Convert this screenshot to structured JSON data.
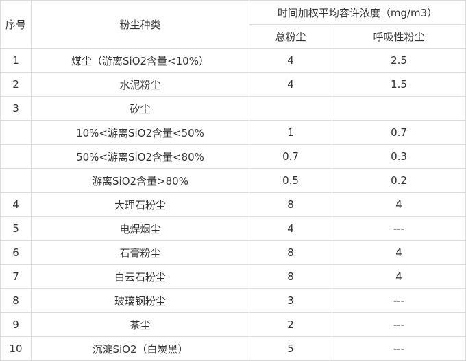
{
  "header": {
    "index": "序号",
    "dust_type": "粉尘种类",
    "twa_group": "时间加权平均容许浓度（mg/m3）",
    "total_dust": "总粉尘",
    "respirable_dust": "呼吸性粉尘"
  },
  "rows": [
    {
      "index": "1",
      "name": "煤尘（游离SiO2含量<10%）",
      "total": "4",
      "resp": "2.5"
    },
    {
      "index": "2",
      "name": "水泥粉尘",
      "total": "4",
      "resp": "1.5"
    },
    {
      "index": "3",
      "name": "矽尘",
      "total": "",
      "resp": ""
    },
    {
      "index": "",
      "name": "10%<游离SiO2含量<50%",
      "total": "1",
      "resp": "0.7"
    },
    {
      "index": "",
      "name": "50%<游离SiO2含量<80%",
      "total": "0.7",
      "resp": "0.3"
    },
    {
      "index": "",
      "name": "游离SiO2含量>80%",
      "total": "0.5",
      "resp": "0.2"
    },
    {
      "index": "4",
      "name": "大理石粉尘",
      "total": "8",
      "resp": "4"
    },
    {
      "index": "5",
      "name": "电焊烟尘",
      "total": "4",
      "resp": "---"
    },
    {
      "index": "6",
      "name": "石膏粉尘",
      "total": "8",
      "resp": "4"
    },
    {
      "index": "7",
      "name": "白云石粉尘",
      "total": "8",
      "resp": "4"
    },
    {
      "index": "8",
      "name": "玻璃钢粉尘",
      "total": "3",
      "resp": "---"
    },
    {
      "index": "9",
      "name": "茶尘",
      "total": "2",
      "resp": "---"
    },
    {
      "index": "10",
      "name": "沉淀SiO2（白炭黑）",
      "total": "5",
      "resp": "---"
    }
  ]
}
